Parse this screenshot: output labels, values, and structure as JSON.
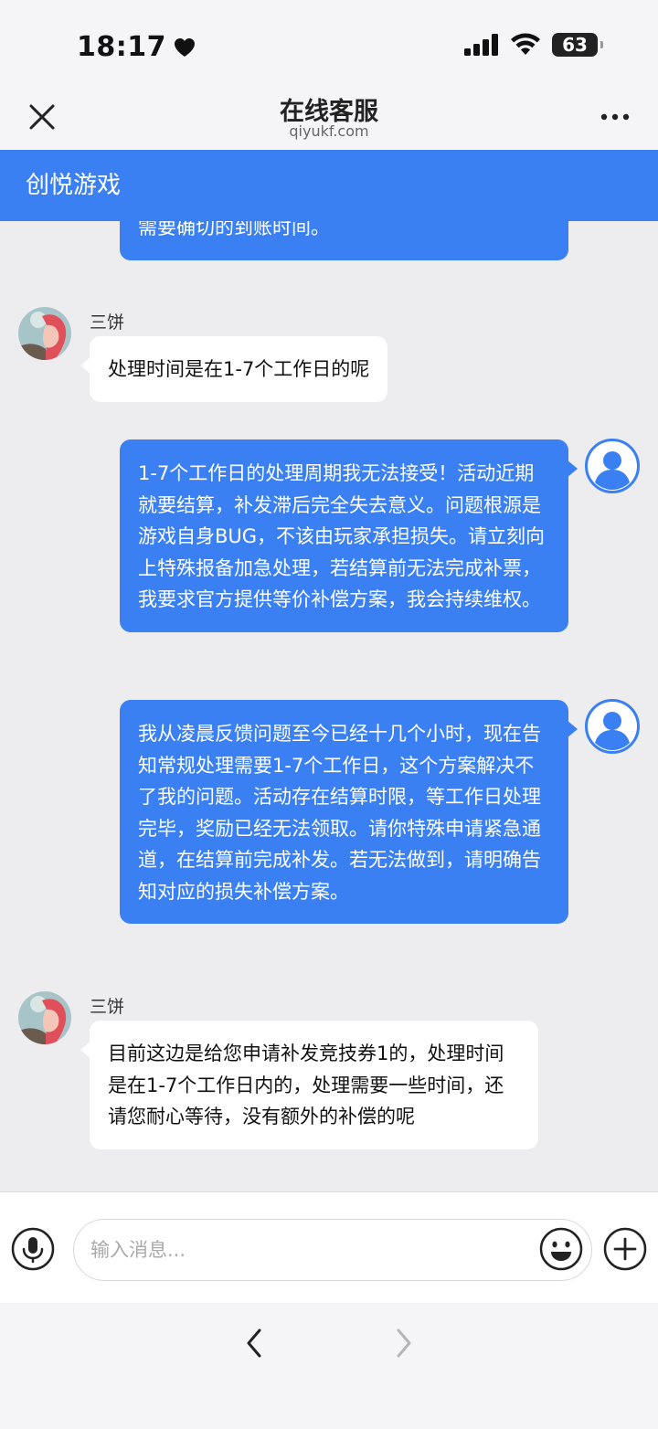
{
  "status_bar": {
    "time": "18:17",
    "battery": "63",
    "icons": [
      "heart-icon",
      "signal-icon",
      "wifi-icon",
      "battery-icon"
    ]
  },
  "nav": {
    "title": "在线客服",
    "subtitle": "qiyukf.com",
    "icons": [
      "close-icon",
      "more-icon"
    ]
  },
  "brand": {
    "name": "创悦游戏",
    "color": "#3a80f2"
  },
  "messages": [
    {
      "from": "user",
      "text": "需要确切的到账时间。"
    },
    {
      "from": "agent",
      "sender": "三饼",
      "text": "处理时间是在1-7个工作日的呢"
    },
    {
      "from": "user",
      "text": "1-7个工作日的处理周期我无法接受！活动近期就要结算，补发滞后完全失去意义。问题根源是游戏自身BUG，不该由玩家承担损失。请立刻向上特殊报备加急处理，若结算前无法完成补票，我要求官方提供等价补偿方案，我会持续维权。"
    },
    {
      "from": "user",
      "text": "我从凌晨反馈问题至今已经十几个小时，现在告知常规处理需要1-7个工作日，这个方案解决不了我的问题。活动存在结算时限，等工作日处理完毕，奖励已经无法领取。请你特殊申请紧急通道，在结算前完成补发。若无法做到，请明确告知对应的损失补偿方案。"
    },
    {
      "from": "agent",
      "sender": "三饼",
      "text": "目前这边是给您申请补发竞技券1的，处理时间是在1-7个工作日内的，处理需要一些时间，还请您耐心等待，没有额外的补偿的呢"
    }
  ],
  "input": {
    "placeholder": "输入消息...",
    "value": "",
    "icons": [
      "microphone-icon",
      "emoji-icon",
      "plus-icon"
    ]
  },
  "bottom_nav": {
    "icons": [
      "back-arrow-icon",
      "forward-arrow-icon"
    ]
  }
}
